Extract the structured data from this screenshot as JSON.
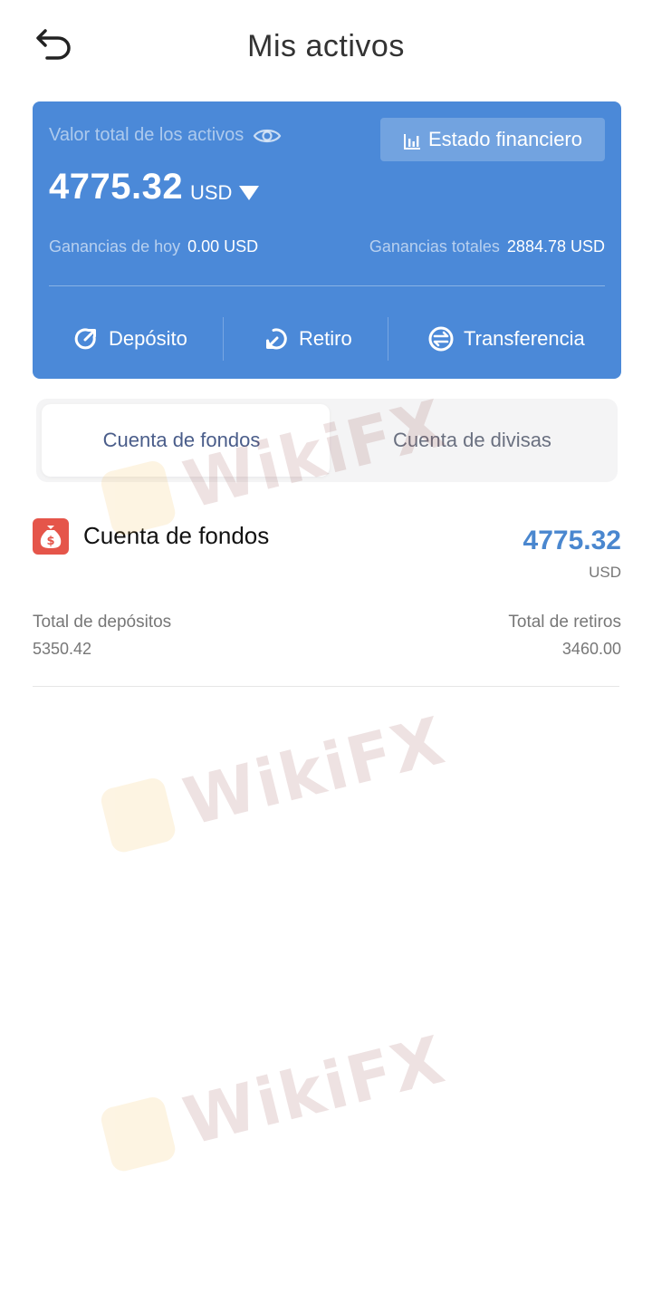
{
  "header": {
    "title": "Mis activos"
  },
  "summary_card": {
    "total_label": "Valor total de los activos",
    "financial_statement_label": "Estado financiero",
    "total_value": "4775.32",
    "currency": "USD",
    "today_earnings_label": "Ganancias de hoy",
    "today_earnings_value": "0.00 USD",
    "total_earnings_label": "Ganancias totales",
    "total_earnings_value": "2884.78 USD",
    "actions": {
      "deposit": "Depósito",
      "withdraw": "Retiro",
      "transfer": "Transferencia"
    },
    "color": "#4b89d8"
  },
  "tabs": {
    "funds": "Cuenta de fondos",
    "forex": "Cuenta de divisas",
    "active": "funds"
  },
  "account": {
    "title": "Cuenta de fondos",
    "value": "4775.32",
    "unit": "USD",
    "deposits_label": "Total de depósitos",
    "deposits_value": "5350.42",
    "withdrawals_label": "Total de retiros",
    "withdrawals_value": "3460.00",
    "icon": "money-bag-icon",
    "icon_color": "#e5554a",
    "value_color": "#4a87cf"
  },
  "watermark": {
    "text": "WikiFX"
  }
}
